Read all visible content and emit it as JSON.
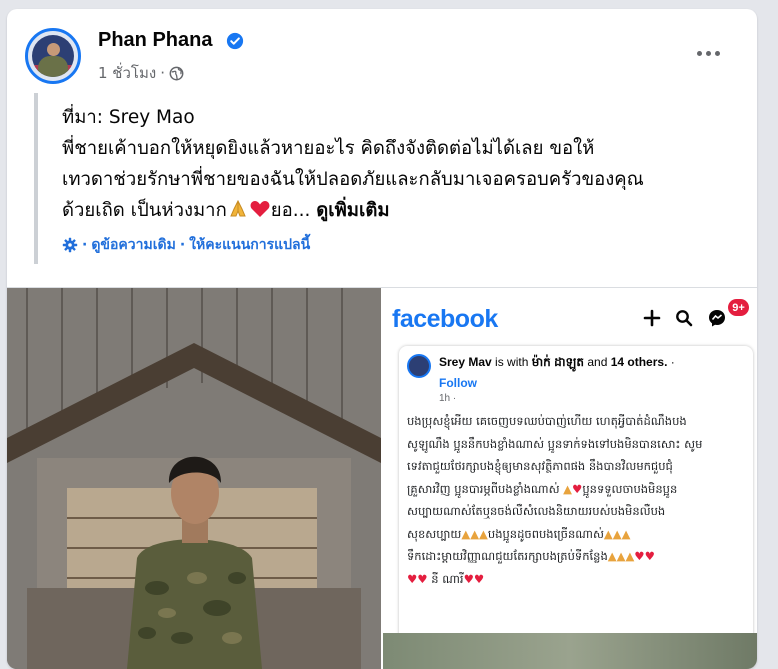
{
  "post": {
    "author": "Phan Phana",
    "time": "1 ชั่วโมง",
    "time_separator": "·",
    "privacy_icon": "globe-icon",
    "more_icon": "more-options-icon"
  },
  "text": {
    "line1": "ที่มา: Srey Mao",
    "line2": "พี่ชายเค้าบอกให้หยุดยิงแล้วหายอะไร คิดถึงจังติดต่อไม่ได้เลย ขอให้",
    "line3": "เทวดาช่วยรักษาพี่ชายของฉันให้ปลอดภัยและกลับมาเจอครอบครัวของคุณ",
    "line4_text": "ด้วยเถิด เป็นห่วงมาก",
    "line4_tail": "ยอ...",
    "see_more": "ดูเพิ่มเติม"
  },
  "translation": {
    "icon": "gear-icon",
    "separator1": "·",
    "see_original": "ดูข้อความเดิม",
    "separator2": "·",
    "rate": "ให้คะแนนการแปลนี้"
  },
  "screenshot": {
    "logo": "facebook",
    "badge": "9+",
    "author": "Srey Mav",
    "with_text": "is with",
    "tagged": "ម៉ាក់ ដាឡូត",
    "and_text": "and",
    "others": "14 others.",
    "follow": "Follow",
    "time": "1h ·",
    "lines": [
      "បងប្រុសខ្ញុំអើយ គេចេញបទឈប់បាញ់ហើយ ហេតុអ្វីបាត់ដំណឹងបង",
      "សូឡូណឹង ប្អូននឹកបងខ្លាំងណាស់ ប្អូនទាក់ទងទៅបងមិនបានសោះ សូម",
      "ទេវតាជួយថែរក្សាបងខ្ញុំឲ្យមានសុវត្ថិភាពផង នឹងបានវិលមកជួបជុំ",
      "គ្រួសារវិញ ប្អូនបារម្ភពីបងខ្លាំងណាស់",
      "សប្បាយណាស់តែឬនចង់លឺសំលេងនិយាយរបស់បងមិនលឺបង",
      "សុខសប្បាយ",
      "ទឹកដោះម្ដាយវិញ្ញាណជួយតែរក្សាបងត្រប់ទីកន្លែង",
      "នី ណារី"
    ],
    "line4_tail": "ប្អូនទទួលចាបងមិនប្អូន",
    "line6_tail": "បងប្អូនដូចពបងច្រើនណាស់"
  },
  "colors": {
    "brand": "#1877f2",
    "link": "#216fdb",
    "heart": "#e41e3f"
  }
}
